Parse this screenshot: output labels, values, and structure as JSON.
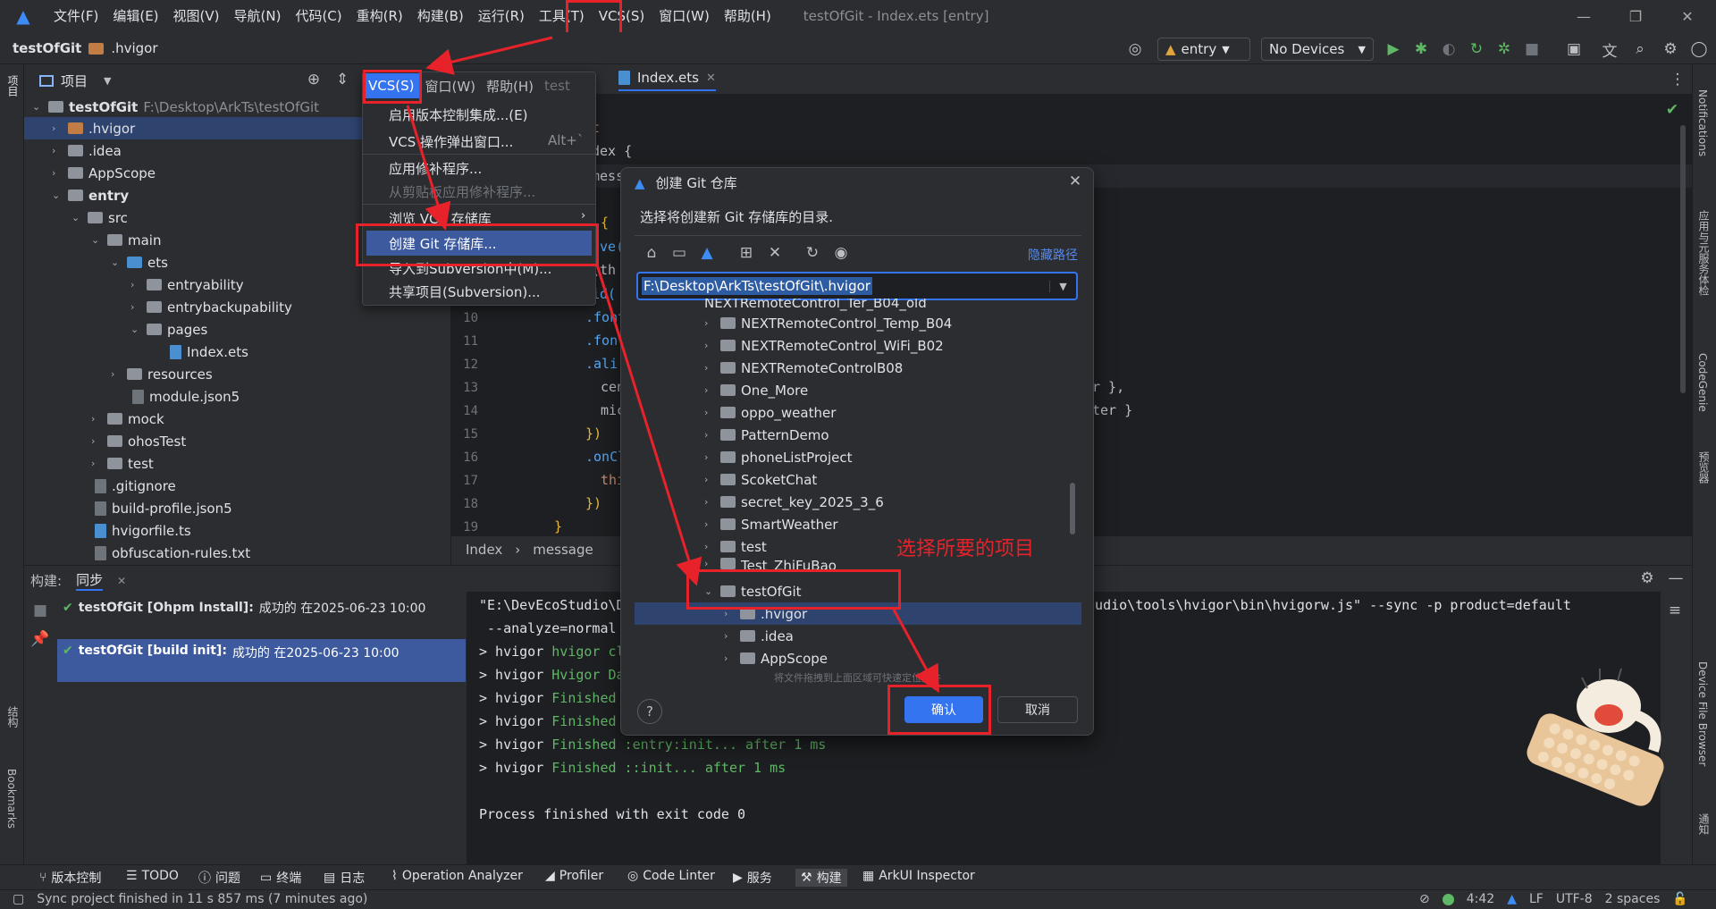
{
  "menubar": {
    "items": [
      "文件(F)",
      "编辑(E)",
      "视图(V)",
      "导航(N)",
      "代码(C)",
      "重构(R)",
      "构建(B)",
      "运行(R)",
      "工具(T)",
      "VCS(S)",
      "窗口(W)",
      "帮助(H)"
    ],
    "title": "testOfGit - Index.ets [entry]"
  },
  "navbar": {
    "project": "testOfGit",
    "folder": ".hvigor",
    "module_select": "entry",
    "device_select": "No Devices"
  },
  "project_panel": {
    "title": "项目",
    "root_name": "testOfGit",
    "root_path": "F:\\Desktop\\ArkTs\\testOfGit",
    "items": [
      ".hvigor",
      ".idea",
      "AppScope",
      "entry",
      "src",
      "main",
      "ets",
      "entryability",
      "entrybackupability",
      "pages",
      "Index.ets",
      "resources",
      "module.json5",
      "mock",
      "ohosTest",
      "test",
      ".gitignore",
      "build-profile.json5",
      "hvigorfile.ts",
      "obfuscation-rules.txt"
    ]
  },
  "editor": {
    "tab": "Index.ets",
    "line_numbers": [
      "10",
      "11",
      "12",
      "13",
      "14",
      "15",
      "16",
      "17",
      "18",
      "19"
    ],
    "code_lines": [
      "t",
      "dex {",
      "mess",
      "{",
      "ive(",
      "(th",
      "id(",
      ".font",
      ".font",
      ".ali",
      "cen",
      "mic",
      "})",
      ".onCl",
      "thi",
      "})",
      "}"
    ],
    "code_right": [
      "r },",
      "ter }"
    ],
    "breadcrumb": [
      "Index",
      "message"
    ]
  },
  "vcs_menu": {
    "header_items": [
      "VCS(S)",
      "窗口(W)",
      "帮助(H)",
      "test"
    ],
    "items": [
      "启用版本控制集成...(E)",
      "VCS 操作弹出窗口...",
      "应用修补程序...",
      "从剪贴板应用修补程序...",
      "浏览 VCS 存储库",
      "创建 Git 存储库...",
      "导入到Subversion中(M)...",
      "共享项目(Subversion)..."
    ],
    "shortcut": "Alt+`"
  },
  "dialog": {
    "title": "创建 Git 仓库",
    "description": "选择将创建新 Git 存储库的目录.",
    "hide_path": "隐藏路径",
    "path_value": "F:\\Desktop\\ArkTs\\testOfGit\\.hvigor",
    "partial_top": "NEXTRemoteControl_Ter_B04_old",
    "tree": [
      "NEXTRemoteControl_Temp_B04",
      "NEXTRemoteControl_WiFi_B02",
      "NEXTRemoteControlB08",
      "One_More",
      "oppo_weather",
      "PatternDemo",
      "phoneListProject",
      "ScoketChat",
      "secret_key_2025_3_6",
      "SmartWeather",
      "test",
      "Test_ZhiFuBao",
      "testOfGit",
      ".hvigor",
      ".idea",
      "AppScope"
    ],
    "drag_hint": "将文件拖拽到上面区域可快速定位文件",
    "confirm": "确认",
    "cancel": "取消",
    "help": "?"
  },
  "annotation": "选择所要的项目",
  "build_panel": {
    "label": "构建:",
    "tab": "同步",
    "tasks": [
      {
        "name": "testOfGit [Ohpm Install]:",
        "status": "成功的 在2025-06-23 10:00"
      },
      {
        "name": "testOfGit [build init]:",
        "status": "成功的 在2025-06-23 10:00"
      }
    ]
  },
  "console": {
    "line1a": "\"E:\\DevEcoStudio\\D",
    "line1b": "Studio\\tools\\hvigor\\bin\\hvigorw.js\" --sync -p product=default",
    "line2": " --analyze=normal",
    "lines": [
      {
        "prefix": "> hvigor ",
        "rest": "hvigor cl"
      },
      {
        "prefix": "> hvigor ",
        "rest": "Hvigor Da"
      },
      {
        "prefix": "> hvigor ",
        "rest": "Finished"
      },
      {
        "prefix": "> hvigor ",
        "rest": "Finished"
      },
      {
        "prefix": "> hvigor ",
        "rest": "Finished :entry:init... after 1 ms"
      },
      {
        "prefix": "> hvigor ",
        "rest": "Finished ::init... after 1 ms"
      }
    ],
    "exit": "Process finished with exit code 0"
  },
  "tool_windows": [
    "版本控制",
    "TODO",
    "问题",
    "终端",
    "日志",
    "Operation Analyzer",
    "Profiler",
    "Code Linter",
    "服务",
    "构建",
    "ArkUI Inspector"
  ],
  "left_strip": [
    "项目",
    "结构",
    "Bookmarks"
  ],
  "right_strip": [
    "Notifications",
    "应用与元服务体检",
    "CodeGenie",
    "预览器",
    "Device File Browser",
    "通知"
  ],
  "status": {
    "message": "Sync project finished in 11 s 857 ms (7 minutes ago)",
    "time": "4:42",
    "line_sep": "LF",
    "encoding": "UTF-8",
    "indent": "2 spaces"
  },
  "colors": {
    "accent": "#3574f0",
    "highlight": "#e8222a",
    "selection": "#2e436e",
    "success": "#5fb865"
  }
}
